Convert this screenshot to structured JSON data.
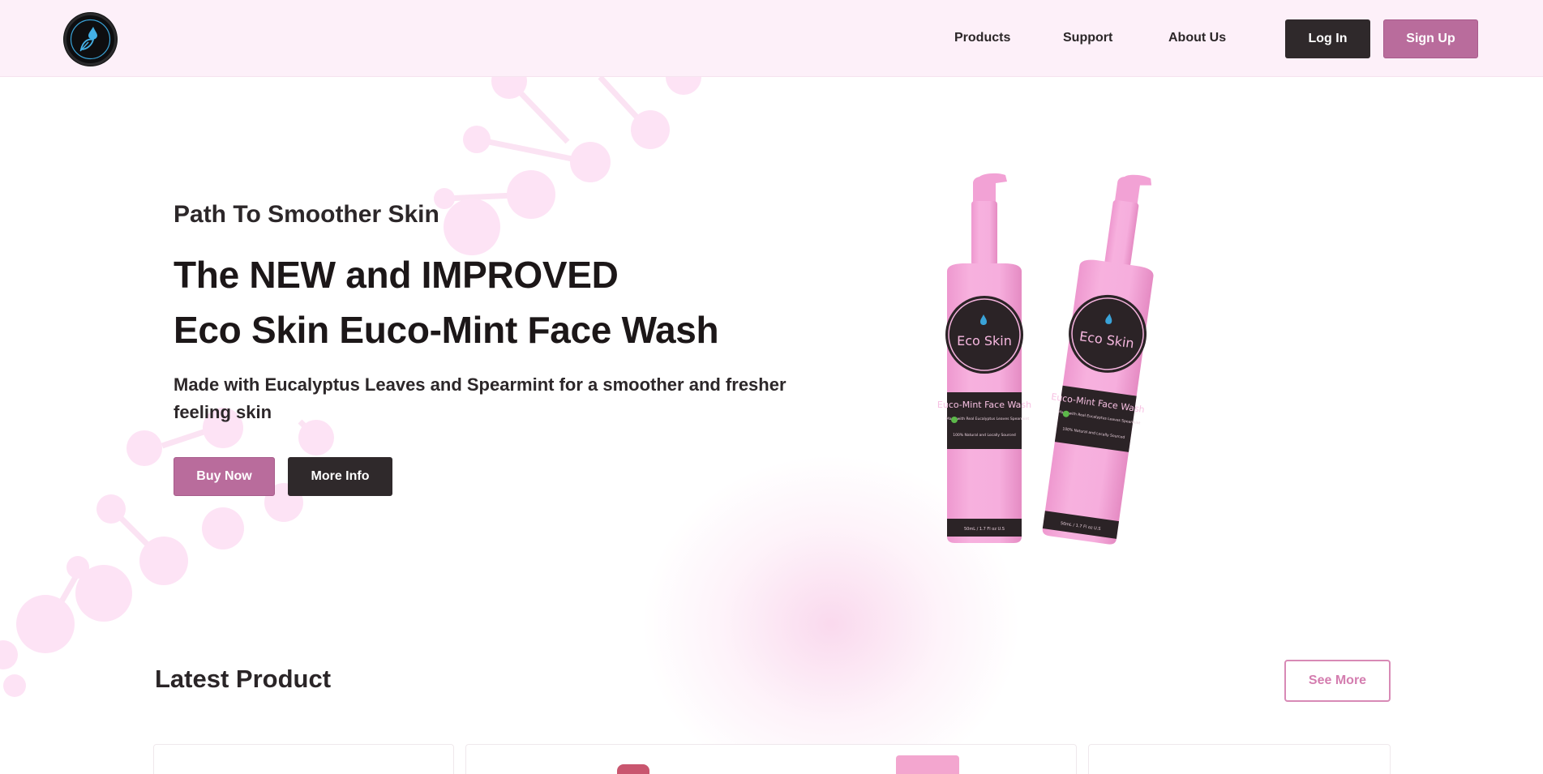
{
  "header": {
    "logo_alt": "Eco Skin",
    "nav": [
      {
        "label": "Products"
      },
      {
        "label": "Support"
      },
      {
        "label": "About Us"
      }
    ],
    "login_label": "Log In",
    "signup_label": "Sign Up"
  },
  "hero": {
    "subtitle": "Path To Smoother Skin",
    "title_line1": "The NEW and IMPROVED",
    "title_line2": "Eco Skin Euco-Mint Face Wash",
    "description": "Made with Eucalyptus Leaves and Spearmint for a smoother and fresher feeling skin",
    "buy_label": "Buy Now",
    "more_label": "More Info",
    "bottle": {
      "brand": "Eco Skin",
      "product": "Euco-Mint Face Wash",
      "made_with": "Made with Real Eucalyptus Leaves Spearmint",
      "sourced": "100% Natural and Locally Sourced",
      "volume": "50mL / 1.7 Fl oz U.S"
    }
  },
  "latest": {
    "title": "Latest Product",
    "see_more_label": "See More"
  },
  "colors": {
    "header_bg": "#fdf0f9",
    "brand_pink": "#b96c9c",
    "dark": "#2f292b",
    "bottle_pink": "#f5a9d9",
    "deco_pink": "#fde3f5"
  }
}
